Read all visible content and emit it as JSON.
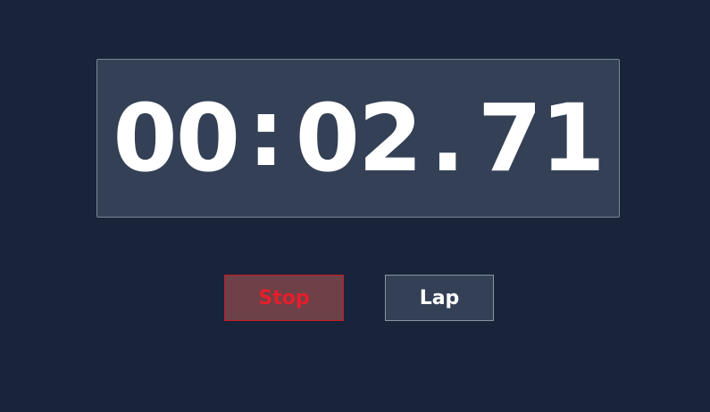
{
  "timer": {
    "minutes": "00",
    "colon": ":",
    "seconds": "02",
    "dot": ".",
    "centiseconds": "71"
  },
  "buttons": {
    "stop_label": "Stop",
    "lap_label": "Lap"
  },
  "colors": {
    "background": "#19233a",
    "display_bg": "#344055",
    "stop_text": "#e61e2b",
    "stop_border": "#c21b2a",
    "stop_bg": "#6e4047",
    "lap_text": "#ffffff"
  }
}
